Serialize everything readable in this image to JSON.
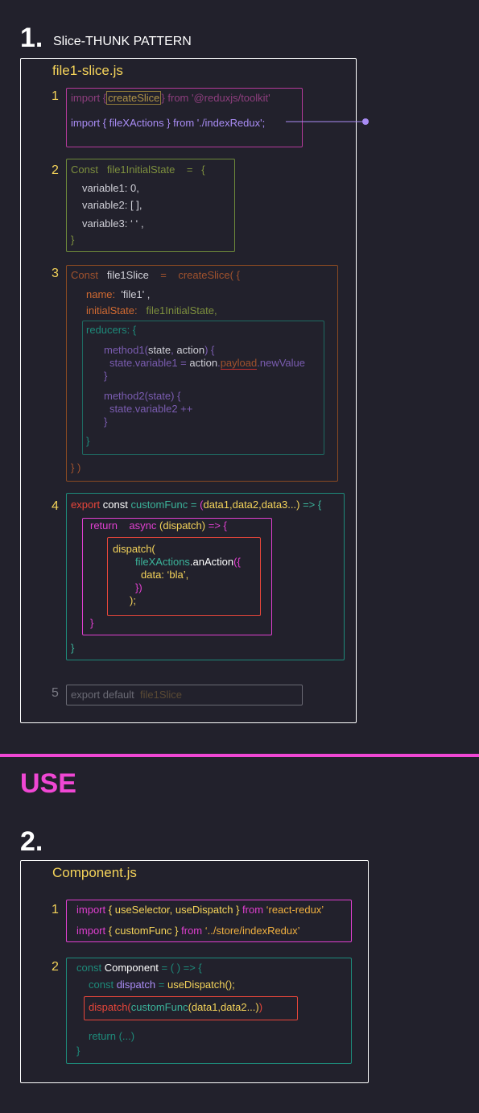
{
  "colors": {
    "bg": "#22212c",
    "white": "#ffffff",
    "yellow": "#f5d45a",
    "purple": "#8e5fb3",
    "violet": "#a98cf5",
    "olive": "#7d8f3e",
    "brown": "#a0522d",
    "orange": "#d06a32",
    "teal": "#1e8a7a",
    "teal_text": "#3bb39a",
    "magenta": "#e040d0",
    "red": "#e8463a",
    "pink": "#f047d4"
  },
  "section1": {
    "number": "1.",
    "title": "Slice-THUNK PATTERN",
    "file_name": "file1-slice.js",
    "blocks": {
      "b1": {
        "num": "1",
        "l1_import": "import",
        "l1_brace_open": "{",
        "l1_createSlice": "createSlice",
        "l1_brace_close": "}",
        "l1_from": "from",
        "l1_path": "'@reduxjs/toolkit'",
        "l2": "import { fileXActions } from './indexRedux';"
      },
      "b2": {
        "num": "2",
        "l1_const": "Const",
        "l1_name": "file1InitialState",
        "l1_eq": "=",
        "l1_brace": "{",
        "v1": "variable1: 0,",
        "v2": "variable2: [ ],",
        "v3": "variable3: ‘ ‘ ,",
        "close": "}"
      },
      "b3": {
        "num": "3",
        "l1_const": "Const",
        "l1_name": "file1Slice",
        "l1_eq": "=",
        "l1_fn": "createSlice( {",
        "name_key": "name:",
        "name_val": "'file1' ,",
        "init_key": "initialState:",
        "init_val": "file1InitialState,",
        "reducers": "reducers:  {",
        "m1_name": "method1",
        "m1_args_open": "(",
        "m1_state": "state",
        "m1_comma": ", ",
        "m1_action": "action",
        "m1_args_close": ") {",
        "m1_body_state": "state",
        "m1_body_var": ".variable1 = ",
        "m1_body_action": "action",
        "m1_body_dot": ".",
        "m1_body_payload": "payload",
        "m1_body_new": ".newValue",
        "m1_close": "}",
        "m2_name": "method2",
        "m2_args_open": "(",
        "m2_state": "state",
        "m2_args_close": ") {",
        "m2_body_state": "state",
        "m2_body_var": ".variable2 ++",
        "m2_close": "}",
        "reducers_close": "}",
        "close": "} )"
      },
      "b4": {
        "num": "4",
        "l1_export": "export",
        "l1_const": "const",
        "l1_name": "customFunc",
        "l1_eq": "=",
        "l1_paren": "(",
        "l1_args": "data1,data2,data3...)",
        "l1_arrow": "=> {",
        "ret": "return",
        "async": "async",
        "dispatch_arg": "(dispatch)",
        "ret_arrow": "=> {",
        "d1": "dispatch(",
        "d2_obj": "fileXActions",
        "d2_fn": ".anAction",
        "d2_paren": "({",
        "d3": "data: ‘bla’,",
        "d4": "})",
        "d5": ");",
        "ret_close": "}",
        "close": "}"
      },
      "b5": {
        "num": "5",
        "export": "export default",
        "name": "file1Slice"
      }
    }
  },
  "use_heading": "USE",
  "section2": {
    "number": "2.",
    "file_name": "Component.js",
    "blocks": {
      "c1": {
        "num": "1",
        "l1_import": "import",
        "l1_open": "{",
        "l1_sel": "useSelector,",
        "l1_disp": "useDispatch",
        "l1_close": "}",
        "l1_from": "from",
        "l1_pkg": "‘react-redux’",
        "l2_import": "import",
        "l2_open": "{",
        "l2_fn": "customFunc",
        "l2_close": "}",
        "l2_from": "from",
        "l2_path": "‘../store/indexRedux’"
      },
      "c2": {
        "num": "2",
        "l1_const": "const",
        "l1_name": "Component",
        "l1_rest": "= ( ) => {",
        "l2_const": "const",
        "l2_name": "dispatch",
        "l2_eq": "=",
        "l2_fn": "useDispatch",
        "l2_paren": "();",
        "l3_disp": "dispatch(",
        "l3_fn": "customFunc",
        "l3_args": "(data1,data2...)",
        "l3_close": ")",
        "l4": "return (...)",
        "close": "}"
      }
    }
  }
}
